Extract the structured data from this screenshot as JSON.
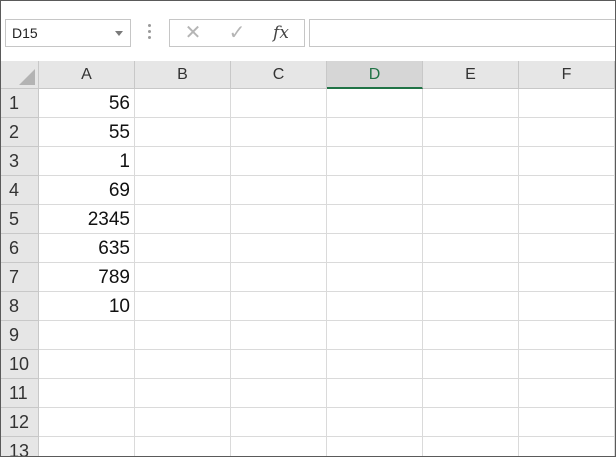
{
  "formula_bar": {
    "name_box": "D15",
    "cancel_glyph": "✕",
    "enter_glyph": "✓",
    "fx_label": "fx",
    "formula": ""
  },
  "columns": [
    "A",
    "B",
    "C",
    "D",
    "E",
    "F"
  ],
  "active_column": "D",
  "rows": [
    "1",
    "2",
    "3",
    "4",
    "5",
    "6",
    "7",
    "8",
    "9",
    "10",
    "11",
    "12",
    "13"
  ],
  "column_a_values": [
    "56",
    "55",
    "1",
    "69",
    "2345",
    "635",
    "789",
    "10",
    "",
    "",
    "",
    "",
    ""
  ]
}
